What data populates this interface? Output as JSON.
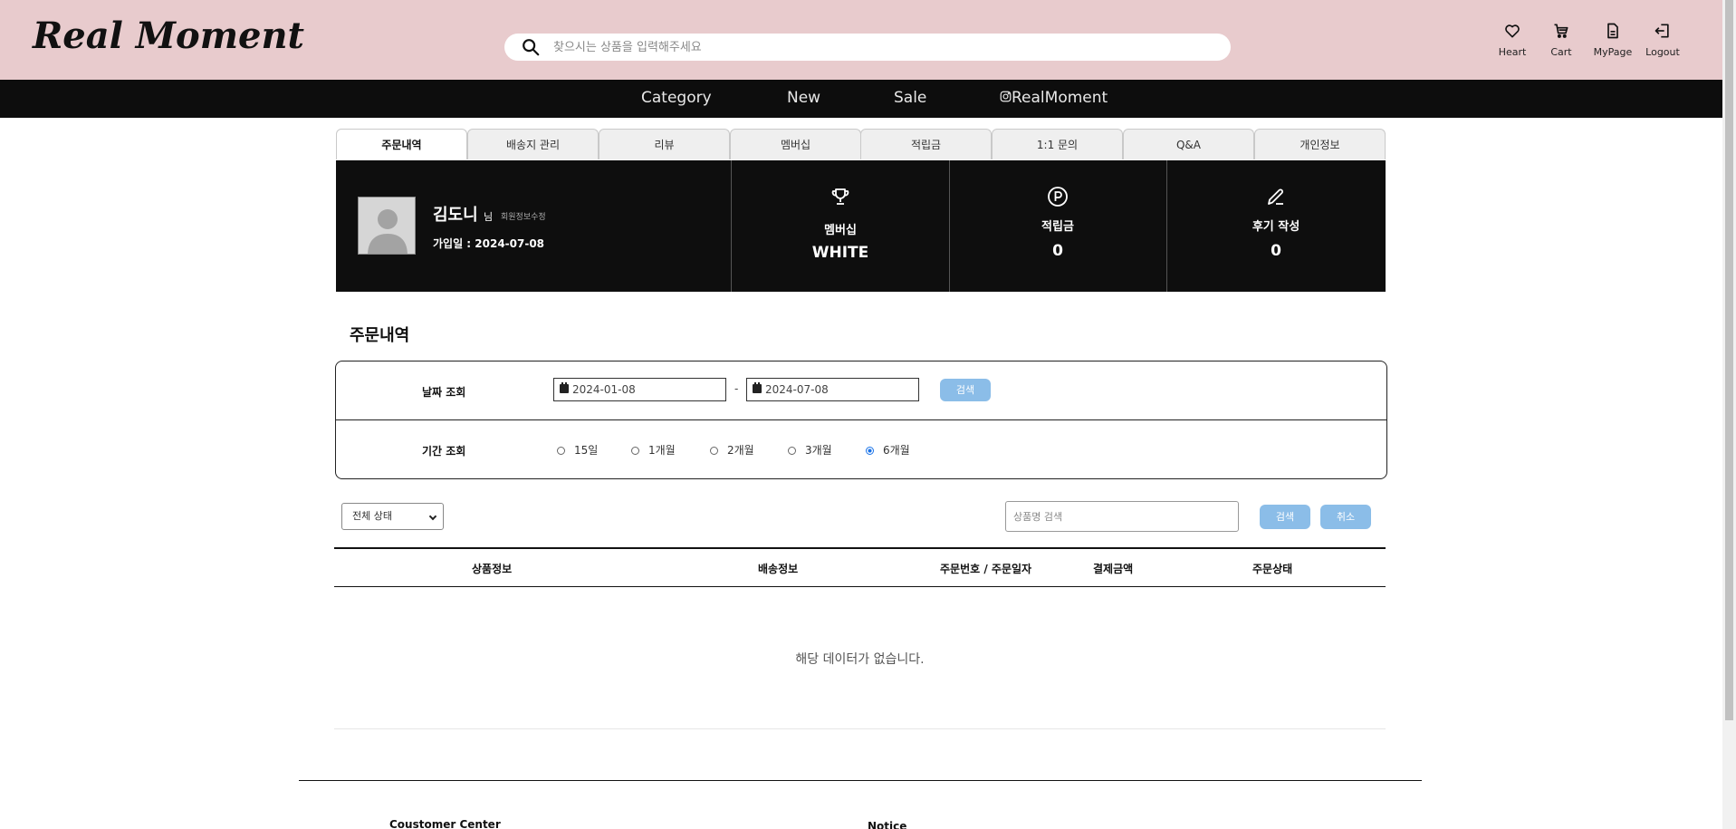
{
  "header": {
    "logo": "Real Moment",
    "search_placeholder": "찾으시는 상품을 입력해주세요",
    "icons": [
      {
        "label": "Heart",
        "icon": "heart-icon"
      },
      {
        "label": "Cart",
        "icon": "cart-icon"
      },
      {
        "label": "MyPage",
        "icon": "document-icon"
      },
      {
        "label": "Logout",
        "icon": "logout-icon"
      }
    ]
  },
  "nav": {
    "category": "Category",
    "new": "New",
    "sale": "Sale",
    "instagram": "RealMoment"
  },
  "tabs": [
    "주문내역",
    "배송지 관리",
    "리뷰",
    "멤버십",
    "적립금",
    "1:1 문의",
    "Q&A",
    "개인정보"
  ],
  "member": {
    "name": "김도니",
    "suffix": "님",
    "edit_label": "회원정보수정",
    "join_date": "가입일 : 2024-07-08",
    "stats": [
      {
        "label": "멤버십",
        "value": "WHITE",
        "icon": "trophy-icon"
      },
      {
        "label": "적립금",
        "value": "0",
        "icon": "point-icon"
      },
      {
        "label": "후기 작성",
        "value": "0",
        "icon": "pencil-icon"
      }
    ]
  },
  "orders": {
    "title": "주문내역",
    "date_label": "날짜 조회",
    "date_from": "2024-01-08",
    "date_to": "2024-07-08",
    "date_separator": "-",
    "search_button": "검색",
    "period_label": "기간 조회",
    "periods": [
      "15일",
      "1개월",
      "2개월",
      "3개월",
      "6개월"
    ],
    "selected_period": "6개월",
    "status_select": "전체 상태",
    "product_search_placeholder": "상품명 검색",
    "product_search_button": "검색",
    "cancel_button": "취소",
    "columns": [
      "상품정보",
      "배송정보",
      "주문번호 / 주문일자",
      "결제금액",
      "주문상태"
    ],
    "empty_message": "해당 데이터가 없습니다."
  },
  "footer": {
    "customer_center": "Coustomer Center",
    "notice": "Notice"
  },
  "colors": {
    "header_bg": "#e8cbcd",
    "nav_bg": "#0d0d0d",
    "accent_button": "#8bbde8"
  }
}
